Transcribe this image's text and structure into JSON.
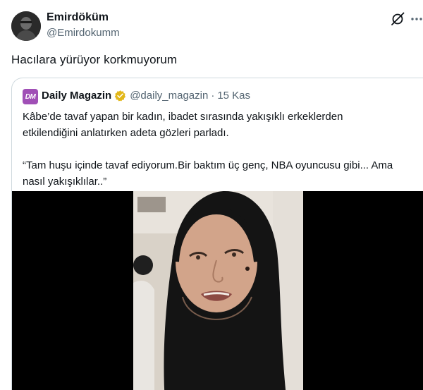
{
  "author": {
    "name": "Emirdöküm",
    "handle": "@Emirdokumm"
  },
  "tweet": {
    "text": "Hacılara yürüyor korkmuyorum"
  },
  "icons": {
    "grok": "grok-icon",
    "more": "more-horizontal-icon",
    "verified": "gold-verified-badge-icon"
  },
  "quoted": {
    "logo_text": "DM",
    "logo_color": "#a04fb6",
    "name": "Daily Magazin",
    "handle": "@daily_magazin",
    "separator": "·",
    "time": "15 Kas",
    "paragraph1_line1": "Kâbe’de tavaf yapan bir kadın, ibadet sırasında yakışıklı erkeklerden",
    "paragraph1_line2": "etkilendiğini anlatırken adeta gözleri parladı.",
    "paragraph2_line1": "“Tam huşu içinde tavaf ediyorum.Bir baktım üç genç, NBA oyuncusu gibi... Ama",
    "paragraph2_line2": "nasıl yakışıklılar..”"
  },
  "colors": {
    "text": "#0f1419",
    "secondary": "#536471",
    "border": "#cfd9de",
    "verified_gold": "#e2b719"
  }
}
